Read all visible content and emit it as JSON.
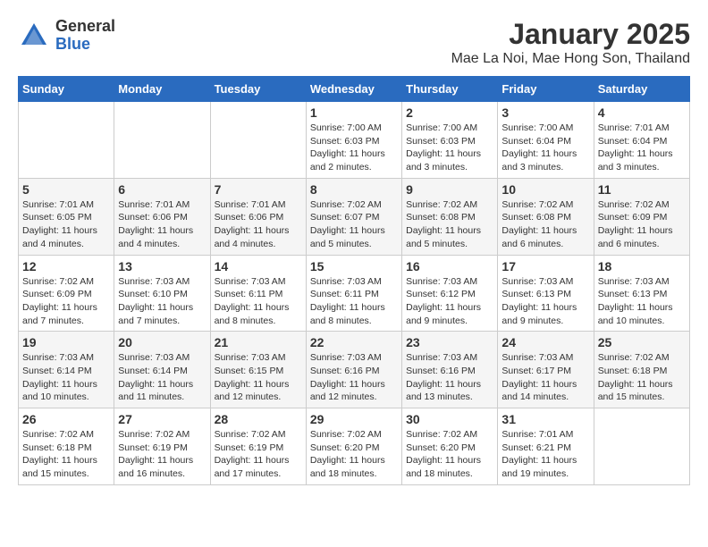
{
  "header": {
    "logo_general": "General",
    "logo_blue": "Blue",
    "title": "January 2025",
    "subtitle": "Mae La Noi, Mae Hong Son, Thailand"
  },
  "weekdays": [
    "Sunday",
    "Monday",
    "Tuesday",
    "Wednesday",
    "Thursday",
    "Friday",
    "Saturday"
  ],
  "weeks": [
    [
      {
        "day": "",
        "info": ""
      },
      {
        "day": "",
        "info": ""
      },
      {
        "day": "",
        "info": ""
      },
      {
        "day": "1",
        "info": "Sunrise: 7:00 AM\nSunset: 6:03 PM\nDaylight: 11 hours\nand 2 minutes."
      },
      {
        "day": "2",
        "info": "Sunrise: 7:00 AM\nSunset: 6:03 PM\nDaylight: 11 hours\nand 3 minutes."
      },
      {
        "day": "3",
        "info": "Sunrise: 7:00 AM\nSunset: 6:04 PM\nDaylight: 11 hours\nand 3 minutes."
      },
      {
        "day": "4",
        "info": "Sunrise: 7:01 AM\nSunset: 6:04 PM\nDaylight: 11 hours\nand 3 minutes."
      }
    ],
    [
      {
        "day": "5",
        "info": "Sunrise: 7:01 AM\nSunset: 6:05 PM\nDaylight: 11 hours\nand 4 minutes."
      },
      {
        "day": "6",
        "info": "Sunrise: 7:01 AM\nSunset: 6:06 PM\nDaylight: 11 hours\nand 4 minutes."
      },
      {
        "day": "7",
        "info": "Sunrise: 7:01 AM\nSunset: 6:06 PM\nDaylight: 11 hours\nand 4 minutes."
      },
      {
        "day": "8",
        "info": "Sunrise: 7:02 AM\nSunset: 6:07 PM\nDaylight: 11 hours\nand 5 minutes."
      },
      {
        "day": "9",
        "info": "Sunrise: 7:02 AM\nSunset: 6:08 PM\nDaylight: 11 hours\nand 5 minutes."
      },
      {
        "day": "10",
        "info": "Sunrise: 7:02 AM\nSunset: 6:08 PM\nDaylight: 11 hours\nand 6 minutes."
      },
      {
        "day": "11",
        "info": "Sunrise: 7:02 AM\nSunset: 6:09 PM\nDaylight: 11 hours\nand 6 minutes."
      }
    ],
    [
      {
        "day": "12",
        "info": "Sunrise: 7:02 AM\nSunset: 6:09 PM\nDaylight: 11 hours\nand 7 minutes."
      },
      {
        "day": "13",
        "info": "Sunrise: 7:03 AM\nSunset: 6:10 PM\nDaylight: 11 hours\nand 7 minutes."
      },
      {
        "day": "14",
        "info": "Sunrise: 7:03 AM\nSunset: 6:11 PM\nDaylight: 11 hours\nand 8 minutes."
      },
      {
        "day": "15",
        "info": "Sunrise: 7:03 AM\nSunset: 6:11 PM\nDaylight: 11 hours\nand 8 minutes."
      },
      {
        "day": "16",
        "info": "Sunrise: 7:03 AM\nSunset: 6:12 PM\nDaylight: 11 hours\nand 9 minutes."
      },
      {
        "day": "17",
        "info": "Sunrise: 7:03 AM\nSunset: 6:13 PM\nDaylight: 11 hours\nand 9 minutes."
      },
      {
        "day": "18",
        "info": "Sunrise: 7:03 AM\nSunset: 6:13 PM\nDaylight: 11 hours\nand 10 minutes."
      }
    ],
    [
      {
        "day": "19",
        "info": "Sunrise: 7:03 AM\nSunset: 6:14 PM\nDaylight: 11 hours\nand 10 minutes."
      },
      {
        "day": "20",
        "info": "Sunrise: 7:03 AM\nSunset: 6:14 PM\nDaylight: 11 hours\nand 11 minutes."
      },
      {
        "day": "21",
        "info": "Sunrise: 7:03 AM\nSunset: 6:15 PM\nDaylight: 11 hours\nand 12 minutes."
      },
      {
        "day": "22",
        "info": "Sunrise: 7:03 AM\nSunset: 6:16 PM\nDaylight: 11 hours\nand 12 minutes."
      },
      {
        "day": "23",
        "info": "Sunrise: 7:03 AM\nSunset: 6:16 PM\nDaylight: 11 hours\nand 13 minutes."
      },
      {
        "day": "24",
        "info": "Sunrise: 7:03 AM\nSunset: 6:17 PM\nDaylight: 11 hours\nand 14 minutes."
      },
      {
        "day": "25",
        "info": "Sunrise: 7:02 AM\nSunset: 6:18 PM\nDaylight: 11 hours\nand 15 minutes."
      }
    ],
    [
      {
        "day": "26",
        "info": "Sunrise: 7:02 AM\nSunset: 6:18 PM\nDaylight: 11 hours\nand 15 minutes."
      },
      {
        "day": "27",
        "info": "Sunrise: 7:02 AM\nSunset: 6:19 PM\nDaylight: 11 hours\nand 16 minutes."
      },
      {
        "day": "28",
        "info": "Sunrise: 7:02 AM\nSunset: 6:19 PM\nDaylight: 11 hours\nand 17 minutes."
      },
      {
        "day": "29",
        "info": "Sunrise: 7:02 AM\nSunset: 6:20 PM\nDaylight: 11 hours\nand 18 minutes."
      },
      {
        "day": "30",
        "info": "Sunrise: 7:02 AM\nSunset: 6:20 PM\nDaylight: 11 hours\nand 18 minutes."
      },
      {
        "day": "31",
        "info": "Sunrise: 7:01 AM\nSunset: 6:21 PM\nDaylight: 11 hours\nand 19 minutes."
      },
      {
        "day": "",
        "info": ""
      }
    ]
  ]
}
